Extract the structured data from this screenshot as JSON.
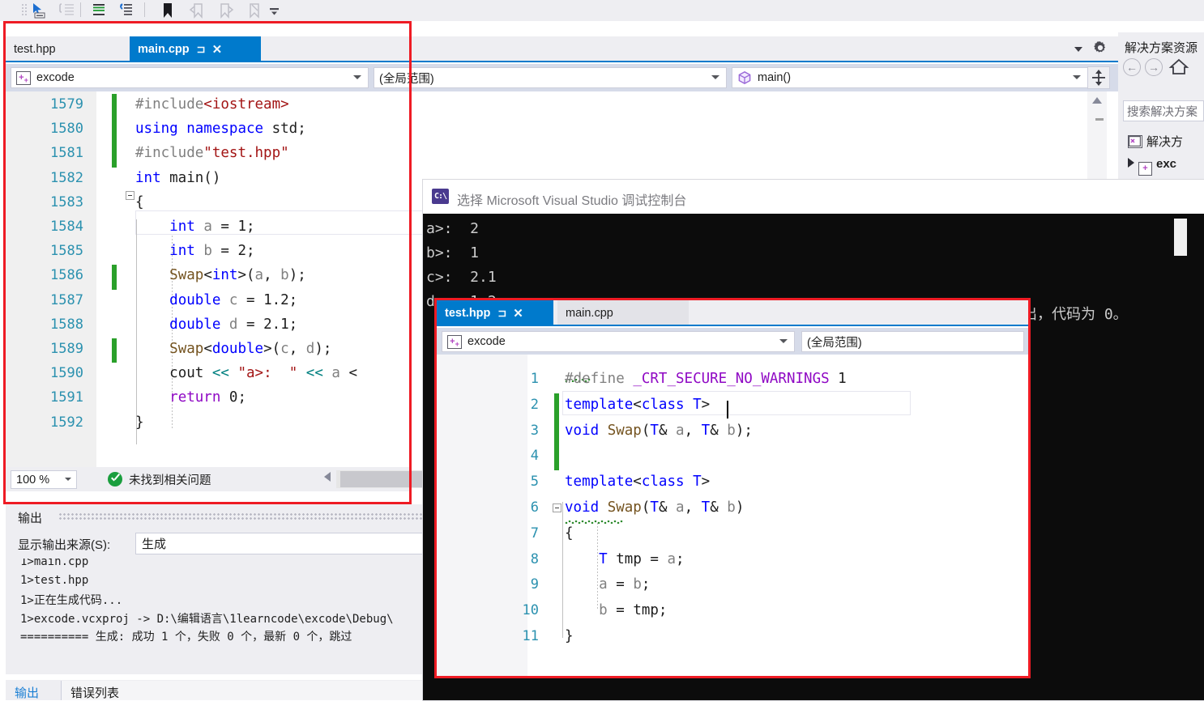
{
  "toolbar": {
    "icons": [
      "pointer-insert-icon",
      "comment-selection-icon",
      "uncomment-selection-icon",
      "increase-indent-icon",
      "decrease-indent-icon",
      "toggle-bookmark-icon",
      "previous-bookmark-icon",
      "next-bookmark-icon",
      "clear-bookmarks-icon",
      "toolbar-overflow-icon"
    ]
  },
  "main_editor": {
    "tabs": [
      {
        "label": "test.hpp",
        "active": false,
        "pin": "",
        "close": ""
      },
      {
        "label": "main.cpp",
        "active": true,
        "pin": "⊐",
        "close": "✕"
      }
    ],
    "navbar": {
      "project": "excode",
      "project_icon": "cpp-project-icon",
      "scope": "(全局范围)",
      "member": "main()",
      "member_icon": "method-cube-icon",
      "split_icon": "split-window-icon"
    },
    "zoom_level": "100 %",
    "status_text": "未找到相关问题",
    "status_icon": "ok-check-icon",
    "lines": [
      {
        "num": "1579",
        "changed": true,
        "fold": false,
        "text": "#include<iostream>"
      },
      {
        "num": "1580",
        "changed": true,
        "fold": false,
        "text": "using namespace std;"
      },
      {
        "num": "1581",
        "changed": true,
        "fold": false,
        "text": "#include\"test.hpp\""
      },
      {
        "num": "1582",
        "changed": false,
        "fold": true,
        "text": "int main()"
      },
      {
        "num": "1583",
        "changed": false,
        "fold": false,
        "text": "{"
      },
      {
        "num": "1584",
        "changed": false,
        "fold": false,
        "text": "    int a = 1;"
      },
      {
        "num": "1585",
        "changed": false,
        "fold": false,
        "text": "    int b = 2;"
      },
      {
        "num": "1586",
        "changed": true,
        "fold": false,
        "text": "    Swap<int>(a, b);"
      },
      {
        "num": "1587",
        "changed": false,
        "fold": false,
        "text": "    double c = 1.2;"
      },
      {
        "num": "1588",
        "changed": false,
        "fold": false,
        "text": "    double d = 2.1;"
      },
      {
        "num": "1589",
        "changed": true,
        "fold": false,
        "text": "    Swap<double>(c, d);"
      },
      {
        "num": "1590",
        "changed": false,
        "fold": false,
        "text": "    cout << \"a>:  \" << a <"
      },
      {
        "num": "1591",
        "changed": false,
        "fold": false,
        "text": "    return 0;"
      },
      {
        "num": "1592",
        "changed": false,
        "fold": false,
        "text": "}"
      }
    ]
  },
  "hpp_editor": {
    "tabs": [
      {
        "label": "test.hpp",
        "active": true,
        "pin": "⊐",
        "close": "✕"
      },
      {
        "label": "main.cpp",
        "active": false,
        "pin": "",
        "close": ""
      }
    ],
    "navbar": {
      "project": "excode",
      "project_icon": "cpp-project-icon",
      "scope": "(全局范围)"
    },
    "lines": [
      {
        "num": "1",
        "changed": false,
        "fold": false,
        "text": "#define _CRT_SECURE_NO_WARNINGS 1"
      },
      {
        "num": "2",
        "changed": true,
        "fold": false,
        "text": "template<class T>"
      },
      {
        "num": "3",
        "changed": true,
        "fold": false,
        "text": "void Swap(T& a, T& b);"
      },
      {
        "num": "4",
        "changed": true,
        "fold": false,
        "text": ""
      },
      {
        "num": "5",
        "changed": false,
        "fold": false,
        "text": "template<class T>"
      },
      {
        "num": "6",
        "changed": false,
        "fold": true,
        "text": "void Swap(T& a, T& b)"
      },
      {
        "num": "7",
        "changed": false,
        "fold": false,
        "text": "{"
      },
      {
        "num": "8",
        "changed": false,
        "fold": false,
        "text": "    T tmp = a;"
      },
      {
        "num": "9",
        "changed": false,
        "fold": false,
        "text": "    a = b;"
      },
      {
        "num": "10",
        "changed": false,
        "fold": false,
        "text": "    b = tmp;"
      },
      {
        "num": "11",
        "changed": false,
        "fold": false,
        "text": "}"
      }
    ]
  },
  "output_panel": {
    "title": "输出",
    "source_label": "显示输出来源(S):",
    "source_value": "生成",
    "log": [
      "1>main.cpp",
      "1>test.hpp",
      "1>正在生成代码...",
      "1>excode.vcxproj -> D:\\编辑语言\\1learncode\\excode\\Debug\\",
      "========== 生成: 成功 1 个，失败 0 个，最新 0 个，跳过"
    ],
    "tabs": [
      "输出",
      "错误列表"
    ]
  },
  "solution_explorer": {
    "title": "解决方案资源",
    "nav": {
      "back": "←",
      "forward": "→",
      "home": "⌂"
    },
    "search_placeholder": "搜索解决方案",
    "items": [
      {
        "label": "解决方",
        "icon": "solution-icon",
        "bold": false
      },
      {
        "label": "exc",
        "icon": "cpp-project-icon",
        "bold": true,
        "expander": "▲"
      }
    ]
  },
  "console": {
    "title": "选择 Microsoft Visual Studio 调试控制台",
    "icon_text": "C:\\",
    "lines": [
      "a>:  2",
      "b>:  1",
      "c>:  2.1",
      "d>:  1.2"
    ],
    "tail_text": "出，代码为 0。"
  },
  "colors": {
    "accent": "#007acc",
    "highlight_border": "#ee1b24",
    "changed_marker": "#2aa02a",
    "keyword": "#0000ff",
    "preprocessor": "#808080",
    "string": "#a31515",
    "type": "#2b91af",
    "function": "#74531f",
    "control": "#8f08c4",
    "operator": "#008080",
    "linenumber": "#2b91af",
    "console_bg": "#0c0c0c",
    "chrome_bg": "#eeeef2"
  }
}
